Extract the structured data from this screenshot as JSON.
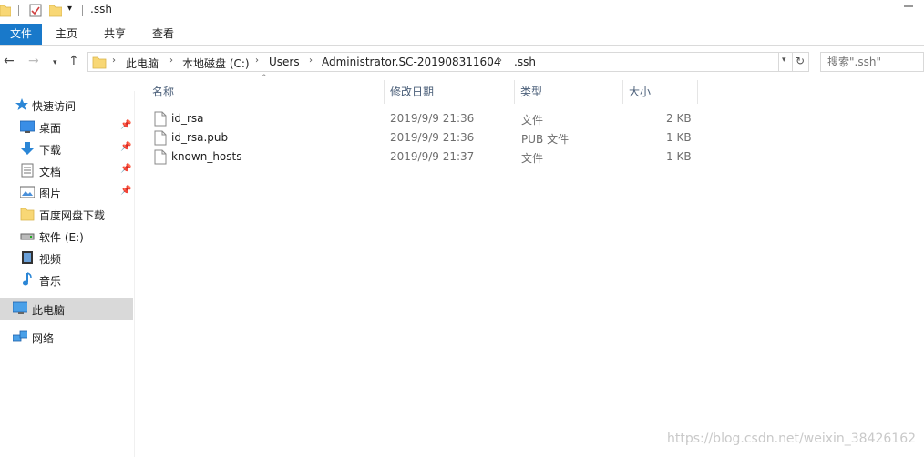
{
  "window": {
    "title": ".ssh"
  },
  "ribbon": {
    "tabs": [
      "文件",
      "主页",
      "共享",
      "查看"
    ]
  },
  "address": {
    "crumbs": [
      "此电脑",
      "本地磁盘 (C:)",
      "Users",
      "Administrator.SC-201908311604",
      ".ssh"
    ],
    "search_placeholder": "搜索\".ssh\""
  },
  "sidebar": {
    "items": [
      {
        "label": "快速访问",
        "icon": "star-icon"
      },
      {
        "label": "桌面",
        "icon": "desktop-icon",
        "pinned": true
      },
      {
        "label": "下载",
        "icon": "download-arrow-icon",
        "pinned": true
      },
      {
        "label": "文档",
        "icon": "document-icon",
        "pinned": true
      },
      {
        "label": "图片",
        "icon": "picture-icon",
        "pinned": true
      },
      {
        "label": "百度网盘下载",
        "icon": "folder-icon"
      },
      {
        "label": "软件 (E:)",
        "icon": "drive-icon"
      },
      {
        "label": "视频",
        "icon": "video-icon"
      },
      {
        "label": "音乐",
        "icon": "music-note-icon"
      },
      {
        "label": "此电脑",
        "icon": "computer-icon",
        "selected": true
      },
      {
        "label": "网络",
        "icon": "network-icon"
      }
    ]
  },
  "columns": [
    "名称",
    "修改日期",
    "类型",
    "大小"
  ],
  "files": [
    {
      "name": "id_rsa",
      "date": "2019/9/9 21:36",
      "type": "文件",
      "size": "2 KB"
    },
    {
      "name": "id_rsa.pub",
      "date": "2019/9/9 21:36",
      "type": "PUB 文件",
      "size": "1 KB"
    },
    {
      "name": "known_hosts",
      "date": "2019/9/9 21:37",
      "type": "文件",
      "size": "1 KB"
    }
  ],
  "watermark": "https://blog.csdn.net/weixin_38426162",
  "colors": {
    "file_tab": "#1979ca",
    "selected_bg": "#d9d9d9",
    "header_text": "#4c607a",
    "folder": "#f8d775"
  }
}
